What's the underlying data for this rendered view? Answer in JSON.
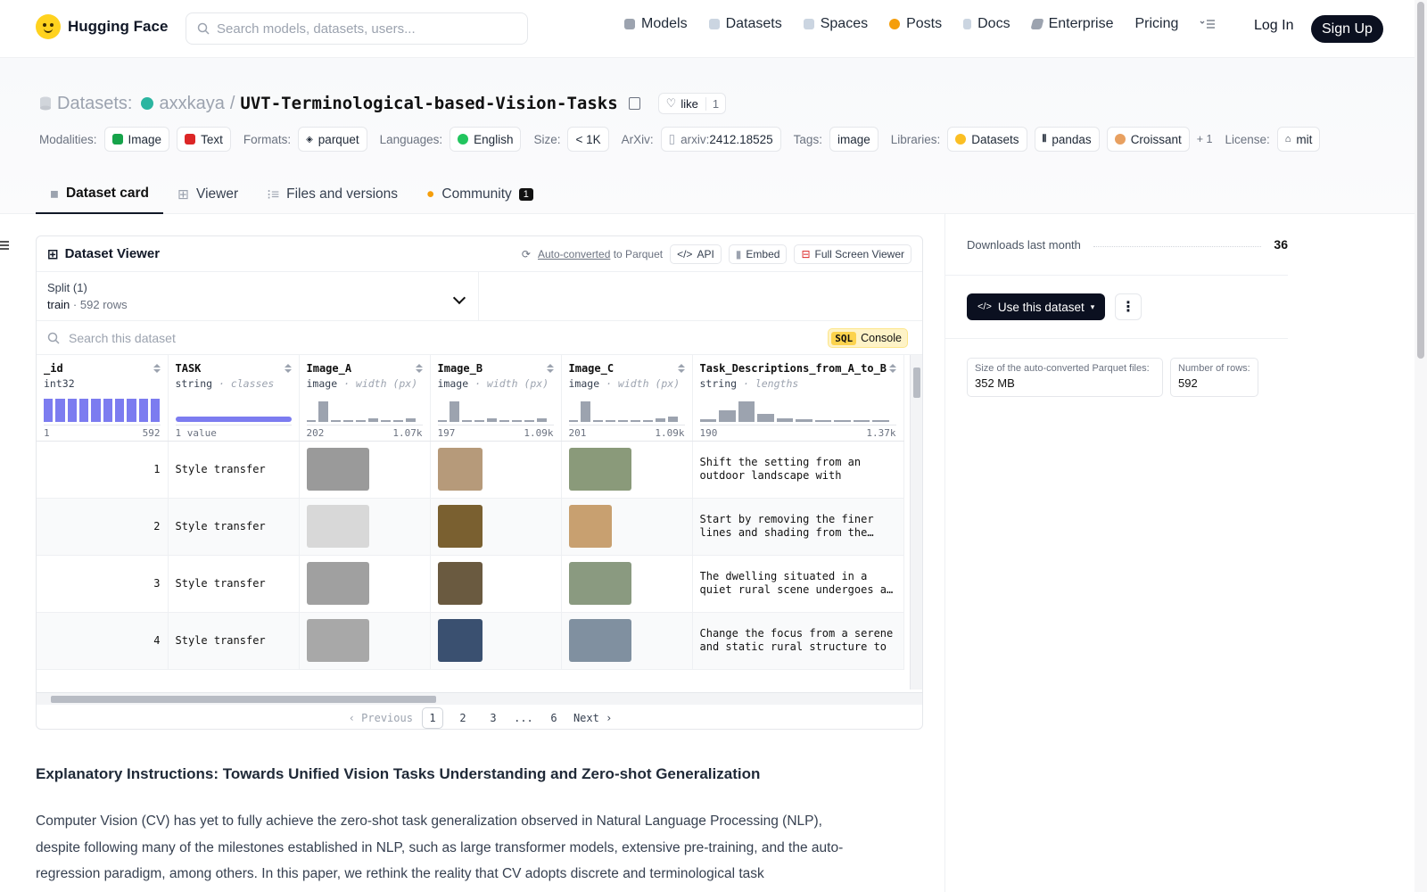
{
  "nav": {
    "brand": "Hugging Face",
    "search_placeholder": "Search models, datasets, users...",
    "items": [
      {
        "label": "Models",
        "color": "#6b7280"
      },
      {
        "label": "Datasets",
        "color": "#9ca3af"
      },
      {
        "label": "Spaces",
        "color": "#9ca3af"
      },
      {
        "label": "Posts",
        "color": "#f59e0b"
      },
      {
        "label": "Docs",
        "color": "#9ca3af"
      },
      {
        "label": "Enterprise",
        "color": "#6b7280"
      }
    ],
    "pricing": "Pricing",
    "login": "Log In",
    "signup": "Sign Up"
  },
  "header": {
    "section": "Datasets:",
    "owner": "axxkaya",
    "sep": "/",
    "repo": "UVT-Terminological-based-Vision-Tasks",
    "like_label": "like",
    "like_count": "1"
  },
  "tags": {
    "modalities_label": "Modalities:",
    "modalities": [
      "Image",
      "Text"
    ],
    "formats_label": "Formats:",
    "format": "parquet",
    "languages_label": "Languages:",
    "language": "English",
    "size_label": "Size:",
    "size": "< 1K",
    "arxiv_label": "ArXiv:",
    "arxiv_prefix": "arxiv:",
    "arxiv": "2412.18525",
    "tags_label": "Tags:",
    "tag": "image",
    "libraries_label": "Libraries:",
    "libraries": [
      "Datasets",
      "pandas",
      "Croissant"
    ],
    "libraries_more": "+ 1",
    "license_label": "License:",
    "license": "mit"
  },
  "tabs": {
    "card": "Dataset card",
    "viewer": "Viewer",
    "files": "Files and versions",
    "community": "Community",
    "community_count": "1"
  },
  "viewer": {
    "title": "Dataset Viewer",
    "auto_converted": "Auto-converted",
    "to_parquet": "to Parquet",
    "api": "API",
    "embed": "Embed",
    "fullscreen": "Full Screen Viewer",
    "split_label": "Split (1)",
    "split_value": "train",
    "split_dot": "·",
    "split_rows": "592 rows",
    "search_placeholder": "Search this dataset",
    "sql": "SQL",
    "console": "Console",
    "columns": [
      {
        "name": "_id",
        "type": "int32",
        "hint": "",
        "hist": [
          1,
          1,
          1,
          1,
          1,
          1,
          1,
          1,
          1,
          1
        ],
        "min": "1",
        "max": "592",
        "purple": true
      },
      {
        "name": "TASK",
        "type": "string",
        "hint": "· classes",
        "hist": [],
        "min": "1 value",
        "max": "",
        "purple": true
      },
      {
        "name": "Image_A",
        "type": "image",
        "hint": "· width (px)",
        "hist": [
          0.05,
          0.9,
          0.05,
          0.05,
          0.05,
          0.15,
          0.05,
          0.05,
          0.15
        ],
        "min": "202",
        "max": "1.07k",
        "purple": false
      },
      {
        "name": "Image_B",
        "type": "image",
        "hint": "· width (px)",
        "hist": [
          0.05,
          0.9,
          0.08,
          0.05,
          0.15,
          0.05,
          0.05,
          0.05,
          0.15
        ],
        "min": "197",
        "max": "1.09k",
        "purple": false
      },
      {
        "name": "Image_C",
        "type": "image",
        "hint": "· width (px)",
        "hist": [
          0.05,
          0.9,
          0.05,
          0.05,
          0.05,
          0.05,
          0.05,
          0.15,
          0.25
        ],
        "min": "201",
        "max": "1.09k",
        "purple": false
      },
      {
        "name": "Task_Descriptions_from_A_to_B",
        "type": "string",
        "hint": "· lengths",
        "hist": [
          0.1,
          0.5,
          0.9,
          0.35,
          0.15,
          0.1,
          0.08,
          0.05,
          0.05,
          0.05
        ],
        "min": "190",
        "max": "1.37k",
        "purple": false
      }
    ],
    "rows": [
      {
        "id": "1",
        "task": "Style transfer",
        "desc": "Shift the setting from an outdoor landscape with visible…",
        "a": "#9a9a9a",
        "b": "#b69a7a",
        "c": "#8a9a7a"
      },
      {
        "id": "2",
        "task": "Style transfer",
        "desc": "Start by removing the finer lines and shading from the…",
        "a": "#d8d8d8",
        "b": "#7a6030",
        "c": "#c8a070"
      },
      {
        "id": "3",
        "task": "Style transfer",
        "desc": "The dwelling situated in a quiet rural scene undergoes a…",
        "a": "#a0a0a0",
        "b": "#6a5a40",
        "c": "#8a9a80"
      },
      {
        "id": "4",
        "task": "Style transfer",
        "desc": "Change the focus from a serene and static rural structure to …",
        "a": "#a8a8a8",
        "b": "#3a5070",
        "c": "#8090a0"
      }
    ],
    "pager": {
      "prev": "Previous",
      "pages": [
        "1",
        "2",
        "3",
        "...",
        "6"
      ],
      "next": "Next"
    }
  },
  "sidebar": {
    "downloads_label": "Downloads last month",
    "downloads": "36",
    "use_dataset": "Use this dataset",
    "parquet_size_label": "Size of the auto-converted Parquet files:",
    "parquet_size": "352 MB",
    "rows_label": "Number of rows:",
    "rows": "592"
  },
  "readme": {
    "heading": "Explanatory Instructions: Towards Unified Vision Tasks Understanding and Zero-shot Generalization",
    "paragraph": "Computer Vision (CV) has yet to fully achieve the zero-shot task generalization observed in Natural Language Processing (NLP), despite following many of the milestones established in NLP, such as large transformer models, extensive pre-training, and the auto-regression paradigm, among others. In this paper, we rethink the reality that CV adopts discrete and terminological task"
  }
}
